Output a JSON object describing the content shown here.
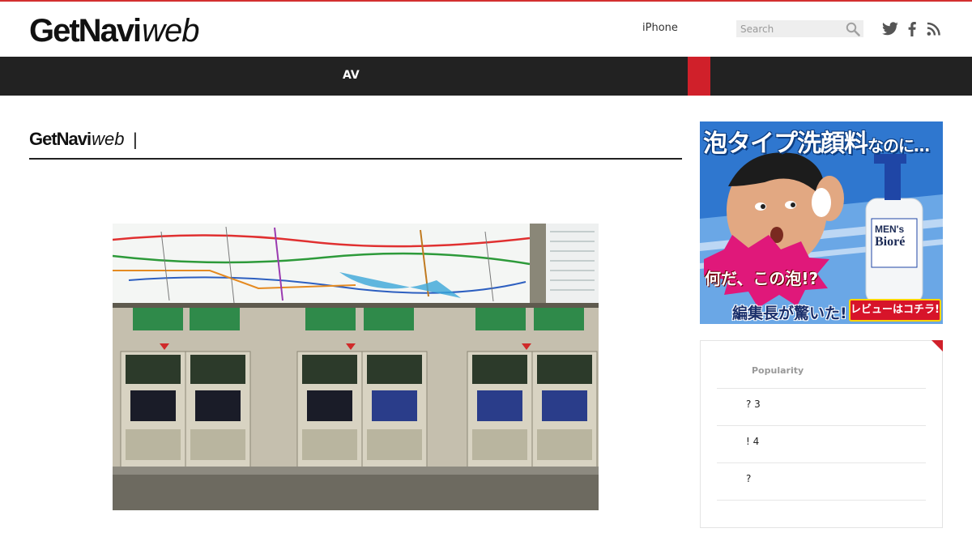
{
  "header": {
    "logo_bold": "GetNavi",
    "logo_light": "web",
    "nav_link": "iPhone",
    "search": {
      "placeholder": "Search"
    },
    "social": [
      "twitter-icon",
      "facebook-icon",
      "rss-icon"
    ]
  },
  "navbar": {
    "item": "AV",
    "accent_color": "#d0202a"
  },
  "main": {
    "section_logo_bold": "GetNavi",
    "section_logo_light": "web",
    "section_separator": "|"
  },
  "ad": {
    "headline": "泡タイプ洗顔料",
    "headline_small": "なのに…",
    "burst": "何だ、この泡!?",
    "sub": "編集長が驚いた!",
    "cta": "レビューはコチラ!",
    "brand_line1": "MEN's",
    "brand_line2": "Bioré"
  },
  "popular": {
    "title": "Popularity",
    "items": [
      "? 3",
      "! 4",
      "?"
    ]
  },
  "colors": {
    "top_line": "#d32f2f",
    "navbar_bg": "#222222",
    "ad_bg": "#2f77cf"
  }
}
